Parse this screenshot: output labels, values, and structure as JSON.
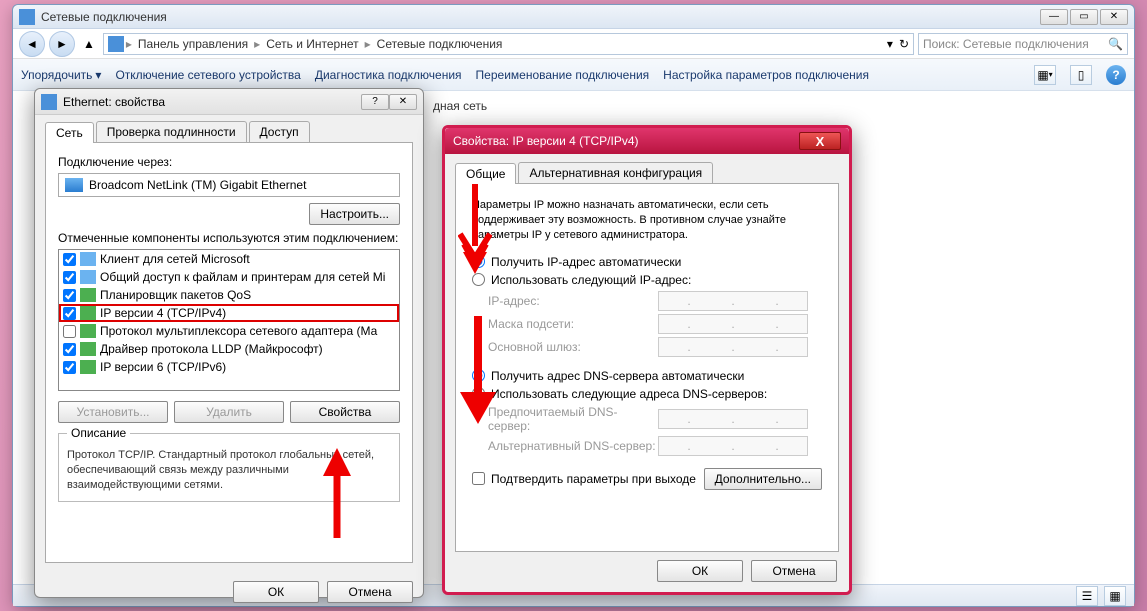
{
  "explorer": {
    "title": "Сетевые подключения",
    "breadcrumbs": [
      "Панель управления",
      "Сеть и Интернет",
      "Сетевые подключения"
    ],
    "search_placeholder": "Поиск: Сетевые подключения",
    "toolbar": {
      "organize": "Упорядочить",
      "disable": "Отключение сетевого устройства",
      "diagnose": "Диагностика подключения",
      "rename": "Переименование подключения",
      "settings": "Настройка параметров подключения"
    },
    "content_hint": "дная сеть"
  },
  "eth_dialog": {
    "title": "Ethernet: свойства",
    "tabs": [
      "Сеть",
      "Проверка подлинности",
      "Доступ"
    ],
    "connect_using_label": "Подключение через:",
    "adapter": "Broadcom NetLink (TM) Gigabit Ethernet",
    "configure_btn": "Настроить...",
    "components_label": "Отмеченные компоненты используются этим подключением:",
    "components": [
      {
        "checked": true,
        "icon": "net",
        "label": "Клиент для сетей Microsoft"
      },
      {
        "checked": true,
        "icon": "net",
        "label": "Общий доступ к файлам и принтерам для сетей Mi"
      },
      {
        "checked": true,
        "icon": "green",
        "label": "Планировщик пакетов QoS"
      },
      {
        "checked": true,
        "icon": "green",
        "label": "IP версии 4 (TCP/IPv4)",
        "selected": true
      },
      {
        "checked": false,
        "icon": "green",
        "label": "Протокол мультиплексора сетевого адаптера (Ма"
      },
      {
        "checked": true,
        "icon": "green",
        "label": "Драйвер протокола LLDP (Майкрософт)"
      },
      {
        "checked": true,
        "icon": "green",
        "label": "IP версии 6 (TCP/IPv6)"
      }
    ],
    "install_btn": "Установить...",
    "uninstall_btn": "Удалить",
    "properties_btn": "Свойства",
    "desc_title": "Описание",
    "desc_text": "Протокол TCP/IP. Стандартный протокол глобальных сетей, обеспечивающий связь между различными взаимодействующими сетями.",
    "ok_btn": "ОК",
    "cancel_btn": "Отмена"
  },
  "ipv4_dialog": {
    "title": "Свойства: IP версии 4 (TCP/IPv4)",
    "tabs": [
      "Общие",
      "Альтернативная конфигурация"
    ],
    "info": "Параметры IP можно назначать автоматически, если сеть поддерживает эту возможность. В противном случае узнайте параметры IP у сетевого администратора.",
    "ip_auto": "Получить IP-адрес автоматически",
    "ip_manual": "Использовать следующий IP-адрес:",
    "ip_label": "IP-адрес:",
    "mask_label": "Маска подсети:",
    "gateway_label": "Основной шлюз:",
    "dns_auto": "Получить адрес DNS-сервера автоматически",
    "dns_manual": "Использовать следующие адреса DNS-серверов:",
    "dns_pref": "Предпочитаемый DNS-сервер:",
    "dns_alt": "Альтернативный DNS-сервер:",
    "validate": "Подтвердить параметры при выходе",
    "advanced_btn": "Дополнительно...",
    "ok_btn": "ОК",
    "cancel_btn": "Отмена"
  }
}
